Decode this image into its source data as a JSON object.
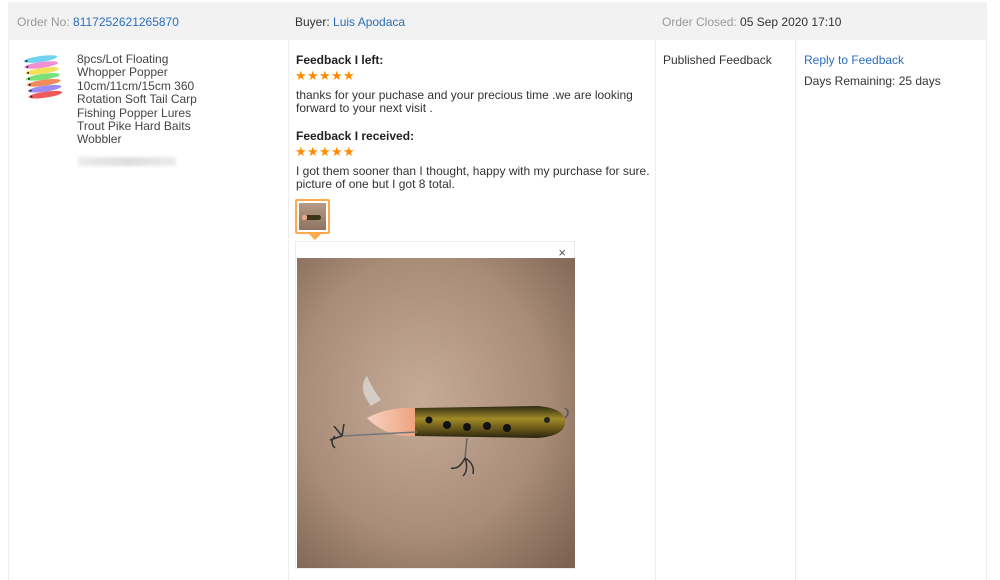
{
  "header": {
    "order_label": "Order No: ",
    "order_number": "8117252621265870",
    "buyer_label": "Buyer: ",
    "buyer_name": "Luis Apodaca",
    "closed_label": "Order Closed: ",
    "closed_date": "05 Sep 2020 17:10"
  },
  "product": {
    "title_lines": [
      "8pcs/Lot Floating",
      "Whopper Popper",
      "10cm/11cm/15cm 360",
      "Rotation Soft Tail Carp",
      "Fishing Popper Lures",
      "Trout Pike Hard Baits",
      "Wobbler"
    ],
    "thumb_icon": "fishing-lures-thumbnail"
  },
  "feedback_left": {
    "heading": "Feedback I left:",
    "rating": 5,
    "text_lines": [
      "thanks for your puchase and your precious time .we are looking",
      "forward to your next visit ."
    ]
  },
  "feedback_received": {
    "heading": "Feedback I received:",
    "rating": 5,
    "text_lines": [
      "I got them sooner than I thought, happy with my purchase for sure.",
      "picture of one but I got 8 total."
    ],
    "photo_icon": "fishing-lure-photo"
  },
  "popup": {
    "close_glyph": "×"
  },
  "status": {
    "published": "Published Feedback"
  },
  "actions": {
    "reply_link": "Reply to Feedback",
    "days_remaining": "Days Remaining: 25 days"
  },
  "colors": {
    "link": "#2a6ebb",
    "star": "#ff8a00",
    "header_bg": "#f2f2f2",
    "thumb_border": "#ffa94d"
  }
}
